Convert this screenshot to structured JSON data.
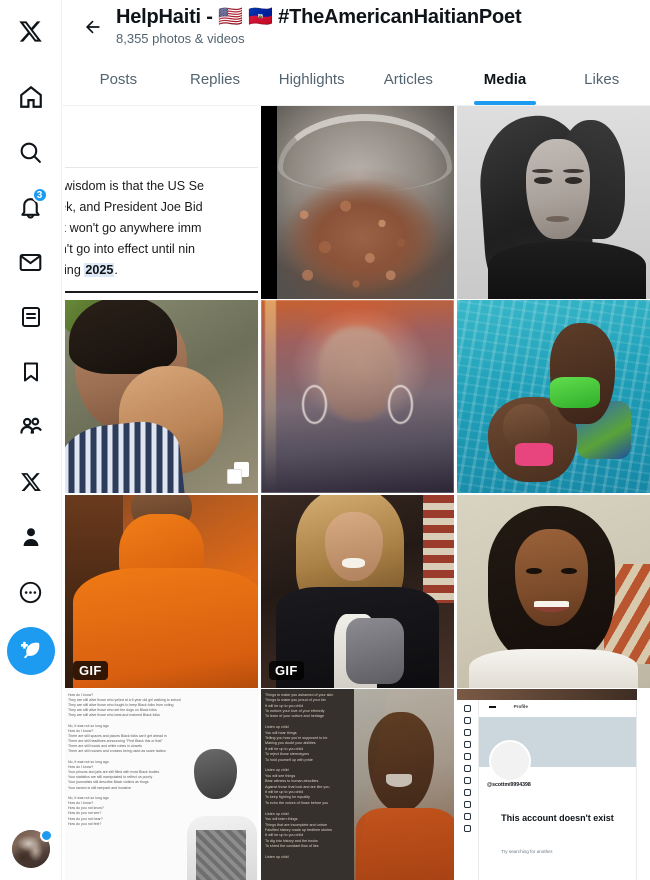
{
  "app": {
    "name": "X",
    "accent_color": "#1d9bf0",
    "text_color": "#0f1419",
    "muted_color": "#536471"
  },
  "sidebar": {
    "primary": [
      {
        "icon": "x-logo-icon",
        "label": "X"
      },
      {
        "icon": "home-icon",
        "label": "Home"
      },
      {
        "icon": "search-icon",
        "label": "Explore"
      },
      {
        "icon": "bell-icon",
        "label": "Notifications",
        "badge": "3"
      },
      {
        "icon": "mail-icon",
        "label": "Messages"
      },
      {
        "icon": "lists-icon",
        "label": "Lists"
      },
      {
        "icon": "bookmark-icon",
        "label": "Bookmarks"
      },
      {
        "icon": "communities-icon",
        "label": "Communities"
      },
      {
        "icon": "x-premium-icon",
        "label": "Premium"
      },
      {
        "icon": "profile-icon",
        "label": "Profile"
      },
      {
        "icon": "more-circle-icon",
        "label": "More"
      }
    ],
    "compose": {
      "icon": "compose-feather-icon",
      "label": "Post"
    },
    "account": {
      "icon": "avatar",
      "label": "Account menu",
      "unread_dot": true
    }
  },
  "header": {
    "back": {
      "icon": "back-arrow-icon",
      "label": "Back"
    },
    "title": "HelpHaiti - 🇺🇸 🇭🇹 #TheAmericanHaitianPoet",
    "subtitle": "8,355 photos & videos"
  },
  "tabs": [
    {
      "label": "Posts",
      "active": false
    },
    {
      "label": "Replies",
      "active": false
    },
    {
      "label": "Highlights",
      "active": false
    },
    {
      "label": "Articles",
      "active": false
    },
    {
      "label": "Media",
      "active": true
    },
    {
      "label": "Likes",
      "active": false
    }
  ],
  "media": {
    "cells": [
      {
        "id": "cell-1",
        "kind": "text-screenshot",
        "description": "Screenshot of an article about TikTok and the US Senate",
        "lines": [
          "nal wisdom is that the US Se",
          " week, and President Joe Bid",
          "tTok won't go anywhere imm",
          "uldn't go into effect until nin",
          "eaning "
        ],
        "highlight": "2025",
        "highlight_suffix": "."
      },
      {
        "id": "cell-2",
        "kind": "video-thumb",
        "description": "Pot of beans simmering on a stove"
      },
      {
        "id": "cell-3",
        "kind": "photo",
        "description": "Black and white selfie portrait of a woman with long curly hair"
      },
      {
        "id": "cell-4",
        "kind": "photo",
        "description": "Woman lying beside a smiling child outdoors",
        "badge": "multi-photo"
      },
      {
        "id": "cell-5",
        "kind": "video-thumb",
        "description": "Blurry video still of a woman wearing large hoop earrings"
      },
      {
        "id": "cell-6",
        "kind": "photo",
        "description": "Woman holding a toddler with green armbands in a swimming pool"
      },
      {
        "id": "cell-7",
        "kind": "gif",
        "badge_label": "GIF",
        "description": "Person in an orange turtleneck sweater"
      },
      {
        "id": "cell-8",
        "kind": "gif",
        "badge_label": "GIF",
        "description": "Blonde woman laughing while holding a handbag"
      },
      {
        "id": "cell-9",
        "kind": "photo",
        "description": "Smiling girl with braided hair in a white top"
      },
      {
        "id": "cell-10",
        "kind": "text-image",
        "description": "Poem document with a photo of a boy in overalls",
        "poem": "How do I know?\nThey are still alive those who yelled at a 6 year old girl walking to school\nThey are still alive those who fought to keep Black folks from voting\nThey are still alive those who set the dogs on Black folks\nThey are still alive those who beat and maimed Black folks\n\nNo, it was not so long ago\nHow do I know?\nThere are still spaces and places Black folks can't get ahead in\nThere are still headlines announcing \"First Black this or that\"\nThere are still hoods and white robes in closets\nThere are still nooses and crosses being used as scare tactics\n\nNo, it was not so long ago\nHow do I know?\nYour prisons and jails are still filled with most Black bodies\nYour statistics are still manipulated to reflect us poorly\nYour journalists still describe Black victims as thugs\nYour racism is still rampant and invasive\n\nNo, it was not so long ago\nHow do I know?\nHow do you not know?\nHow do you not see?\nHow do you not hear?\nHow do you not feel?"
      },
      {
        "id": "cell-11",
        "kind": "text-image",
        "description": "Poem overlaid on a photo of a smiling boy in an orange tank top",
        "poem": "Things to make you ashamed of your skin\nThings to make you proud of your kin\nIt will be up to you child\nTo nurture your love of your ethnicity\nTo learn of your culture and heritage\n\nListen up child\nYou will hear things\nTelling you how you're supposed to be\nMaking you doubt your abilities\nIt will be up to you child\nTo reject those stereotypes\nTo hold yourself up with pride\n\nListen up child\nYou will see things\nBear witness to human atrocities\nAgainst those that look and are like you\nIt will be up to you child\nTo keep fighting for equality\nTo echo the voices of those before you\n\nListen up child\nYou will learn things\nThings that are incomplete and untrue\nFalsified history made up bedtime stories\nIt will be up to you child\nTo dig into history and the books\nTo shred the constant flow of lies\n\nListen up child"
      },
      {
        "id": "cell-12",
        "kind": "screenshot",
        "description": "Screenshot of an X profile page that does not exist",
        "nav_label": "Profile",
        "handle": "@scottmi9994398",
        "title": "This account doesn't exist",
        "subtitle": "Try searching for another."
      }
    ]
  }
}
